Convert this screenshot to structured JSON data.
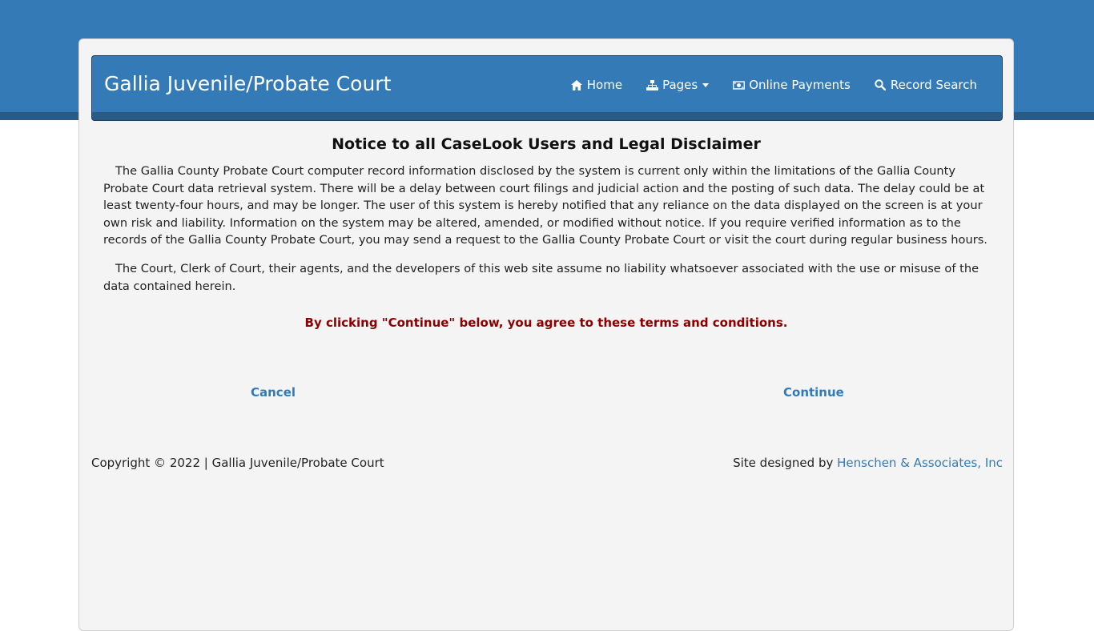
{
  "navbar": {
    "brand": "Gallia Juvenile/Probate Court",
    "items": [
      {
        "label": "Home",
        "icon": "home-icon"
      },
      {
        "label": "Pages",
        "icon": "sitemap-icon",
        "has_caret": true
      },
      {
        "label": "Online Payments",
        "icon": "money-icon"
      },
      {
        "label": "Record Search",
        "icon": "search-icon"
      }
    ]
  },
  "notice": {
    "title": "Notice to all CaseLook Users and Legal Disclaimer",
    "paragraph1": "The Gallia County Probate Court computer record information disclosed by the system is current only within the limitations of the Gallia County Probate Court data retrieval system. There will be a delay between court filings and judicial action and the posting of such data. The delay could be at least twenty-four hours, and may be longer. The user of this system is hereby notified that any reliance on the data displayed on the screen is at your own risk and liability. Information on the system may be altered, amended, or modified without notice. If you require verified information as to the records of the Gallia County Probate Court, you may send a request to the Gallia County Probate Court or visit the court during regular business hours.",
    "paragraph2": "The Court, Clerk of Court, their agents, and the developers of this web site assume no liability whatsoever associated with the use or misuse of the data contained herein.",
    "agree_text": "By clicking \"Continue\" below, you agree to these terms and conditions."
  },
  "actions": {
    "cancel_label": "Cancel",
    "continue_label": "Continue"
  },
  "footer": {
    "copyright": "Copyright © 2022 | Gallia Juvenile/Probate Court",
    "designed_by_prefix": "Site designed by ",
    "designer_link": "Henschen & Associates, Inc"
  },
  "colors": {
    "primary": "#337ab7",
    "primary_dark": "#2a5a86",
    "warning_text": "#8b0000",
    "card_bg": "#f4f4f4"
  }
}
